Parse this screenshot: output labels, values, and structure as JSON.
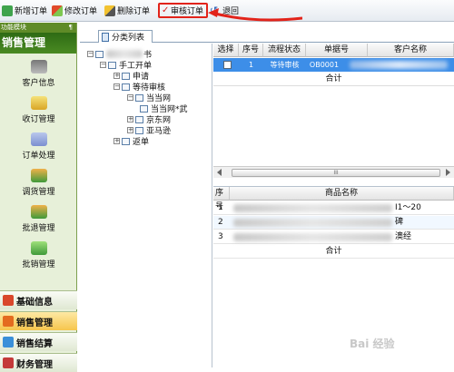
{
  "toolbar": {
    "new_order": "新增订单",
    "edit_order": "修改订单",
    "delete_order": "删除订单",
    "audit_order": "审核订单",
    "back": "退回"
  },
  "left_panel": {
    "module_header": "功能模块",
    "pin": "¶",
    "section_title": "销售管理",
    "items": [
      "客户信息",
      "收订管理",
      "订单处理",
      "调货管理",
      "批退管理",
      "批销管理"
    ],
    "categories": [
      "基础信息",
      "销售管理",
      "销售结算",
      "财务管理"
    ]
  },
  "tab": {
    "label": "分类列表"
  },
  "tree": {
    "root_suffix": "书",
    "manual": "手工开单",
    "apply": "申请",
    "pending": "等待审核",
    "dangdang": "当当网",
    "dangdang_child": "当当网*武",
    "jd": "京东网",
    "amazon": "亚马逊",
    "returns": "返单"
  },
  "order_grid": {
    "columns": [
      "选择",
      "序号",
      "流程状态",
      "单据号",
      "客户名称"
    ],
    "row": {
      "index": "1",
      "status": "等待审核",
      "doc_no": "OB0001"
    },
    "total_label": "合计",
    "scroll_grip": "III"
  },
  "item_grid": {
    "columns": [
      "序号",
      "商品名称"
    ],
    "rows": [
      {
        "no": "1",
        "tail": "I1～20"
      },
      {
        "no": "2",
        "tail": "碑"
      },
      {
        "no": "3",
        "tail": "澳经"
      }
    ],
    "total_label": "合计"
  },
  "watermark": "Bai 经验",
  "colors": {
    "accent_red": "#e2231a",
    "selection_blue": "#3d8ee8",
    "module_green": "#5f8b27"
  }
}
